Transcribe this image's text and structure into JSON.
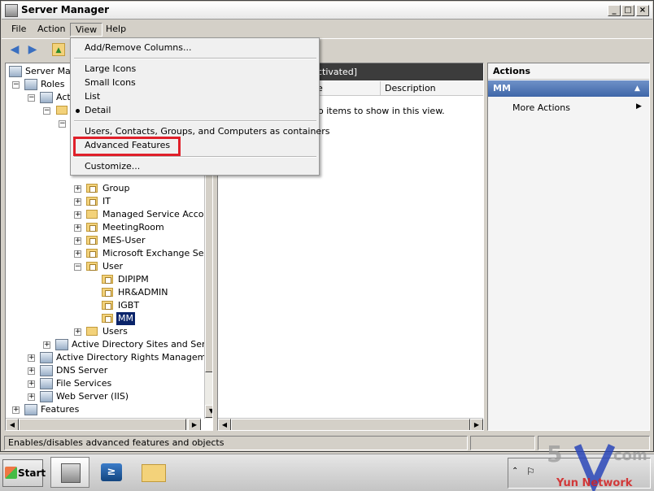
{
  "window": {
    "title": "Server Manager"
  },
  "menu": {
    "file": "File",
    "action": "Action",
    "view": "View",
    "help": "Help"
  },
  "view_menu": {
    "add_remove_columns": "Add/Remove Columns...",
    "large_icons": "Large Icons",
    "small_icons": "Small Icons",
    "list": "List",
    "detail": "Detail",
    "users_contacts": "Users, Contacts, Groups, and Computers as containers",
    "advanced_features": "Advanced Features",
    "customize": "Customize...",
    "checked_item": "Detail",
    "highlight_color": "#e0202a"
  },
  "tree": {
    "items": [
      {
        "label": "Server Mana",
        "icon": "server-manager-icon"
      },
      {
        "label": "Roles",
        "icon": "roles-icon"
      },
      {
        "label": "Acti",
        "icon": "active-directory-icon"
      },
      {
        "label": "Group",
        "icon": "folder-icon"
      },
      {
        "label": "IT",
        "icon": "folder-icon"
      },
      {
        "label": "Managed Service Accoun",
        "icon": "folder-icon"
      },
      {
        "label": "MeetingRoom",
        "icon": "folder-icon"
      },
      {
        "label": "MES-User",
        "icon": "folder-icon"
      },
      {
        "label": "Microsoft Exchange Secu",
        "icon": "folder-icon"
      },
      {
        "label": "User",
        "icon": "folder-icon"
      },
      {
        "label": "DIPIPM",
        "icon": "ou-icon"
      },
      {
        "label": "HR&ADMIN",
        "icon": "ou-icon"
      },
      {
        "label": "IGBT",
        "icon": "ou-icon"
      },
      {
        "label": "MM",
        "icon": "ou-icon"
      },
      {
        "label": "Users",
        "icon": "folder-icon"
      },
      {
        "label": "Active Directory Sites and Service",
        "icon": "ad-sites-icon"
      },
      {
        "label": "Active Directory Rights Management",
        "icon": "ad-rms-icon"
      },
      {
        "label": "DNS Server",
        "icon": "dns-icon"
      },
      {
        "label": "File Services",
        "icon": "file-services-icon"
      },
      {
        "label": "Web Server (IIS)",
        "icon": "iis-icon"
      },
      {
        "label": "Features",
        "icon": "features-icon"
      }
    ],
    "selected": "MM"
  },
  "list": {
    "header_fragment": "ctivated]",
    "col_name_fragment": "e",
    "col_description": "Description",
    "empty_fragment": "o items to show in this view."
  },
  "actions": {
    "title": "Actions",
    "section": "MM",
    "more_actions": "More Actions"
  },
  "status": {
    "text": "Enables/disables advanced features and objects"
  },
  "taskbar": {
    "start": "Start"
  },
  "watermark": {
    "text1": "5",
    "text2": "com",
    "text3": "Yun Network"
  }
}
